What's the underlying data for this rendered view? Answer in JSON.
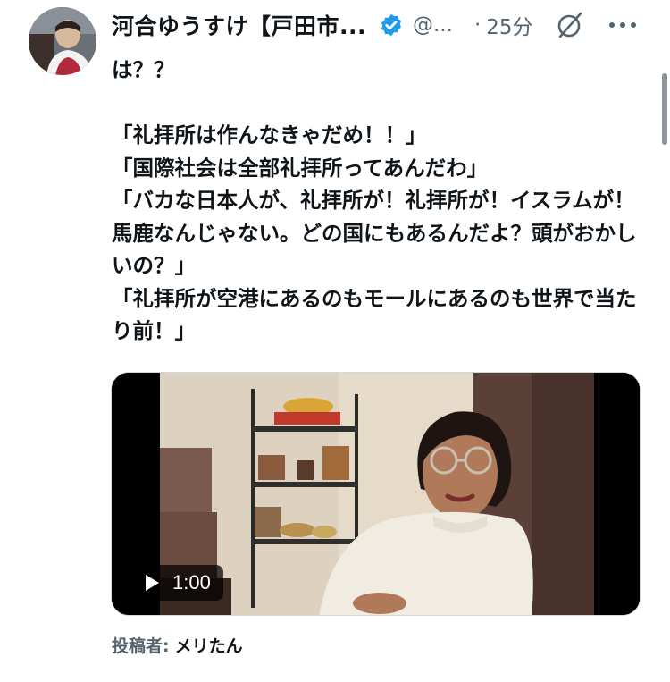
{
  "author": {
    "display_name": "河合ゆうすけ【戸田市...",
    "handle": "@...",
    "separator": "·",
    "time": "25分"
  },
  "post": {
    "text": "は？？\n\n「礼拝所は作んなきゃだめ！！」\n「国際社会は全部礼拝所ってあんだわ」\n「バカな日本人が、礼拝所が！礼拝所が！イスラムが！馬鹿なんじゃない。どの国にもあるんだよ？頭がおかしいの？」\n「礼拝所が空港にあるのもモールにあるのも世界で当たり前！」"
  },
  "video": {
    "duration": "1:00"
  },
  "attribution": {
    "label": "投稿者:",
    "name": "メリたん"
  },
  "icons": {
    "verified": "verified-badge-icon",
    "grok": "grok-icon",
    "more": "more-options-icon",
    "play": "play-icon"
  },
  "colors": {
    "verified": "#1d9bf0",
    "secondary_text": "#536471",
    "primary_text": "#0f1419"
  }
}
